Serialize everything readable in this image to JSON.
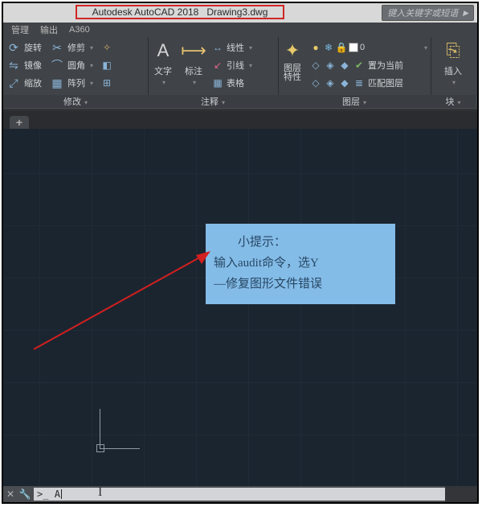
{
  "title": {
    "app_name": "Autodesk AutoCAD 2018",
    "file_name": "Drawing3.dwg"
  },
  "search": {
    "placeholder": "键入关键字或短语"
  },
  "ribbon": {
    "tabs": {
      "t1": "管理",
      "t2": "输出",
      "t3": "A360"
    },
    "modify": {
      "r1": "旋转",
      "r2": "修剪",
      "r3": "镜像",
      "r4": "圆角",
      "r5": "缩放",
      "r6": "阵列",
      "footer": "修改"
    },
    "annot": {
      "text_label": "文字",
      "dim_label": "标注",
      "line1": "线性",
      "line2": "引线",
      "line3": "表格",
      "footer": "注释"
    },
    "layer": {
      "props": "图层\n特性",
      "btn1": "置为当前",
      "btn2": "匹配图层",
      "footer": "图层"
    },
    "block": {
      "insert": "插入",
      "footer": "块"
    }
  },
  "tip": {
    "title": "小提示：",
    "line1": "输入audit命令，选Y",
    "line2": "—修复图形文件错误"
  },
  "command": {
    "prompt": ">_",
    "typed": "A"
  },
  "plus_tab": "+"
}
